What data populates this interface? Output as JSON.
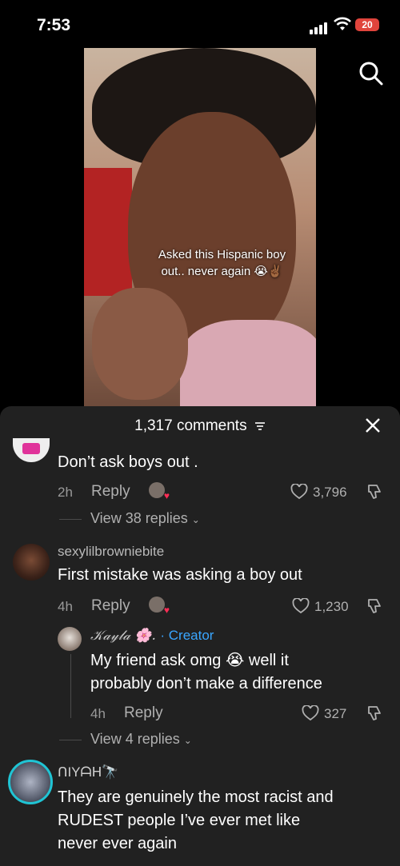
{
  "status": {
    "time": "7:53",
    "battery": "20"
  },
  "video": {
    "caption_line1": "Asked this Hispanic boy",
    "caption_line2": "out.. never again 😭✌🏾"
  },
  "comments_header": {
    "count": "1,317 comments"
  },
  "comments": [
    {
      "text": "Don’t ask boys out .",
      "time": "2h",
      "reply_label": "Reply",
      "likes": "3,796",
      "view_replies": "View 38 replies"
    },
    {
      "username": "sexylilbrowniebite",
      "text": "First mistake was asking a boy out",
      "time": "4h",
      "reply_label": "Reply",
      "likes": "1,230",
      "reply": {
        "username": "𝒦𝒶𝓎𝓁𝒶 🌸.",
        "creator_label": "· Creator",
        "text_line1": "My friend ask omg 😭 well it",
        "text_line2": "probably don’t make a difference",
        "time": "4h",
        "reply_label": "Reply",
        "likes": "327"
      },
      "view_replies": "View 4 replies"
    },
    {
      "username": "ᑎIYᗩᕼ🔭",
      "text_line1": "They are genuinely the most racist and",
      "text_line2": "RUDEST people I’ve ever met like",
      "text_line3": "never ever again"
    }
  ]
}
